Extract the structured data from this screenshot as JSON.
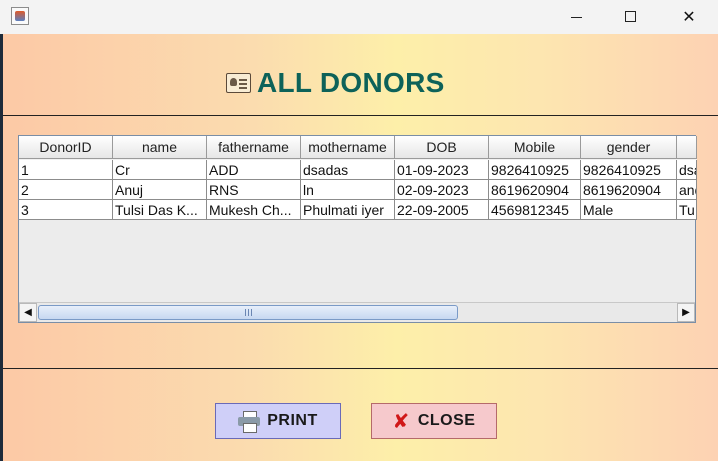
{
  "window": {
    "minimize_glyph": "",
    "close_glyph": "✕"
  },
  "page": {
    "title": "ALL DONORS",
    "title_color": "#0d6259"
  },
  "table": {
    "columns": [
      "DonorID",
      "name",
      "fathername",
      "mothername",
      "DOB",
      "Mobile",
      "gender",
      ""
    ],
    "rows": [
      [
        "1",
        "Cr",
        "ADD",
        "dsadas",
        "01-09-2023",
        "9826410925",
        "9826410925",
        "dsa"
      ],
      [
        "2",
        "Anuj",
        "RNS",
        "ln",
        "02-09-2023",
        "8619620904",
        "8619620904",
        "and"
      ],
      [
        "3",
        "Tulsi  Das K...",
        "Mukesh Ch...",
        "Phulmati iyer",
        "22-09-2005",
        "4569812345",
        "Male",
        "Tu"
      ]
    ]
  },
  "buttons": {
    "print": "PRINT",
    "close": "CLOSE",
    "close_glyph": "✘"
  },
  "icons": {
    "heading": "donor-card-icon",
    "print": "printer-icon",
    "close": "x-icon"
  }
}
